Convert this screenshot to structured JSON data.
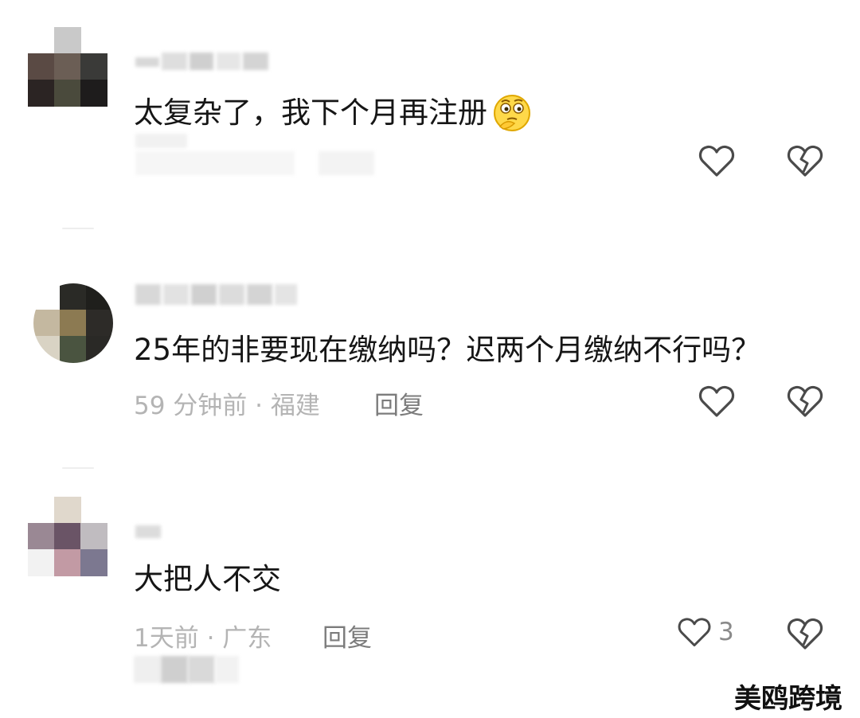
{
  "comments": [
    {
      "text": "太复杂了，我下个月再注册",
      "emoji": "thinking-emoji"
    },
    {
      "text": "25年的非要现在缴纳吗？迟两个月缴纳不行吗？",
      "meta": "59 分钟前 · 福建",
      "reply": "回复"
    },
    {
      "text": "大把人不交",
      "meta": "1天前 · 广东",
      "reply": "回复",
      "like_count": "3"
    }
  ],
  "watermark": "美鸥跨境",
  "icons": [
    "heart-outline-icon",
    "broken-heart-outline-icon"
  ],
  "colors": {
    "text": "#161616",
    "meta": "#b4b4b4",
    "reply": "#7c7c7c",
    "icon": "#4a4a4a"
  }
}
